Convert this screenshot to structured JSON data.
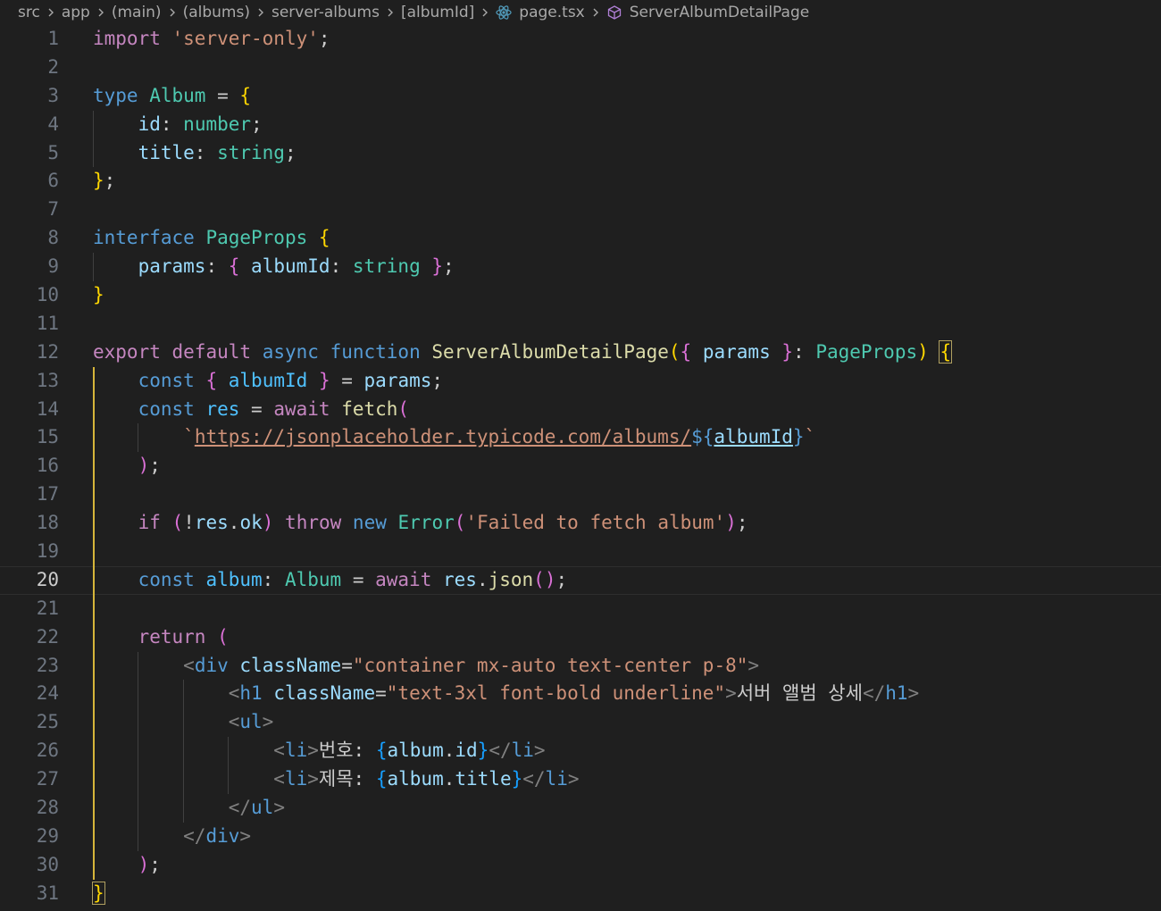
{
  "breadcrumb": {
    "items": [
      "src",
      "app",
      "(main)",
      "(albums)",
      "server-albums",
      "[albumId]"
    ],
    "file": "page.tsx",
    "symbol": "ServerAlbumDetailPage"
  },
  "editor": {
    "current_line": 20,
    "line_numbers": [
      "1",
      "2",
      "3",
      "4",
      "5",
      "6",
      "7",
      "8",
      "9",
      "10",
      "11",
      "12",
      "13",
      "14",
      "15",
      "16",
      "17",
      "18",
      "19",
      "20",
      "21",
      "22",
      "23",
      "24",
      "25",
      "26",
      "27",
      "28",
      "29",
      "30",
      "31"
    ],
    "lines": [
      [
        [
          "ctl",
          "import"
        ],
        [
          "pl",
          " "
        ],
        [
          "str",
          "'server-only'"
        ],
        [
          "pl",
          ";"
        ]
      ],
      [],
      [
        [
          "kw",
          "type"
        ],
        [
          "pl",
          " "
        ],
        [
          "ty",
          "Album"
        ],
        [
          "pl",
          " = "
        ],
        [
          "b1",
          "{"
        ]
      ],
      [
        [
          "pl",
          "    "
        ],
        [
          "var",
          "id"
        ],
        [
          "pl",
          ": "
        ],
        [
          "ty",
          "number"
        ],
        [
          "pl",
          ";"
        ]
      ],
      [
        [
          "pl",
          "    "
        ],
        [
          "var",
          "title"
        ],
        [
          "pl",
          ": "
        ],
        [
          "ty",
          "string"
        ],
        [
          "pl",
          ";"
        ]
      ],
      [
        [
          "b1",
          "}"
        ],
        [
          "pl",
          ";"
        ]
      ],
      [],
      [
        [
          "kw",
          "interface"
        ],
        [
          "pl",
          " "
        ],
        [
          "ty",
          "PageProps"
        ],
        [
          "pl",
          " "
        ],
        [
          "b1",
          "{"
        ]
      ],
      [
        [
          "pl",
          "    "
        ],
        [
          "var",
          "params"
        ],
        [
          "pl",
          ": "
        ],
        [
          "b2",
          "{"
        ],
        [
          "pl",
          " "
        ],
        [
          "var",
          "albumId"
        ],
        [
          "pl",
          ": "
        ],
        [
          "ty",
          "string"
        ],
        [
          "pl",
          " "
        ],
        [
          "b2",
          "}"
        ],
        [
          "pl",
          ";"
        ]
      ],
      [
        [
          "b1",
          "}"
        ]
      ],
      [],
      [
        [
          "ctl",
          "export"
        ],
        [
          "pl",
          " "
        ],
        [
          "ctl",
          "default"
        ],
        [
          "pl",
          " "
        ],
        [
          "kw",
          "async"
        ],
        [
          "pl",
          " "
        ],
        [
          "kw",
          "function"
        ],
        [
          "pl",
          " "
        ],
        [
          "fn",
          "ServerAlbumDetailPage"
        ],
        [
          "b1",
          "("
        ],
        [
          "b2",
          "{"
        ],
        [
          "pl",
          " "
        ],
        [
          "var",
          "params"
        ],
        [
          "pl",
          " "
        ],
        [
          "b2",
          "}"
        ],
        [
          "pl",
          ": "
        ],
        [
          "ty",
          "PageProps"
        ],
        [
          "b1",
          ")"
        ],
        [
          "pl",
          " "
        ],
        [
          "b1",
          "{"
        ]
      ],
      [
        [
          "pl",
          "    "
        ],
        [
          "kw",
          "const"
        ],
        [
          "pl",
          " "
        ],
        [
          "b2",
          "{"
        ],
        [
          "pl",
          " "
        ],
        [
          "const",
          "albumId"
        ],
        [
          "pl",
          " "
        ],
        [
          "b2",
          "}"
        ],
        [
          "pl",
          " = "
        ],
        [
          "var",
          "params"
        ],
        [
          "pl",
          ";"
        ]
      ],
      [
        [
          "pl",
          "    "
        ],
        [
          "kw",
          "const"
        ],
        [
          "pl",
          " "
        ],
        [
          "const",
          "res"
        ],
        [
          "pl",
          " = "
        ],
        [
          "ctl",
          "await"
        ],
        [
          "pl",
          " "
        ],
        [
          "fn",
          "fetch"
        ],
        [
          "b2",
          "("
        ]
      ],
      [
        [
          "pl",
          "        "
        ],
        [
          "str",
          "`"
        ],
        [
          "str",
          "https://jsonplaceholder.typicode.com/albums/"
        ],
        [
          "kw",
          "${"
        ],
        [
          "var",
          "albumId"
        ],
        [
          "kw",
          "}"
        ],
        [
          "str",
          "`"
        ]
      ],
      [
        [
          "pl",
          "    "
        ],
        [
          "b2",
          ")"
        ],
        [
          "pl",
          ";"
        ]
      ],
      [],
      [
        [
          "pl",
          "    "
        ],
        [
          "ctl",
          "if"
        ],
        [
          "pl",
          " "
        ],
        [
          "b2",
          "("
        ],
        [
          "pl",
          "!"
        ],
        [
          "var",
          "res"
        ],
        [
          "pl",
          "."
        ],
        [
          "var",
          "ok"
        ],
        [
          "b2",
          ")"
        ],
        [
          "pl",
          " "
        ],
        [
          "ctl",
          "throw"
        ],
        [
          "pl",
          " "
        ],
        [
          "kw",
          "new"
        ],
        [
          "pl",
          " "
        ],
        [
          "ty",
          "Error"
        ],
        [
          "b2",
          "("
        ],
        [
          "str",
          "'Failed to fetch album'"
        ],
        [
          "b2",
          ")"
        ],
        [
          "pl",
          ";"
        ]
      ],
      [],
      [
        [
          "pl",
          "    "
        ],
        [
          "kw",
          "const"
        ],
        [
          "pl",
          " "
        ],
        [
          "const",
          "album"
        ],
        [
          "pl",
          ": "
        ],
        [
          "ty",
          "Album"
        ],
        [
          "pl",
          " = "
        ],
        [
          "ctl",
          "await"
        ],
        [
          "pl",
          " "
        ],
        [
          "var",
          "res"
        ],
        [
          "pl",
          "."
        ],
        [
          "fn",
          "json"
        ],
        [
          "b2",
          "()"
        ],
        [
          "pl",
          ";"
        ]
      ],
      [],
      [
        [
          "pl",
          "    "
        ],
        [
          "ctl",
          "return"
        ],
        [
          "pl",
          " "
        ],
        [
          "b2",
          "("
        ]
      ],
      [
        [
          "pl",
          "        "
        ],
        [
          "tagp",
          "<"
        ],
        [
          "tag",
          "div"
        ],
        [
          "pl",
          " "
        ],
        [
          "attr",
          "className"
        ],
        [
          "pl",
          "="
        ],
        [
          "str",
          "\"container mx-auto text-center p-8\""
        ],
        [
          "tagp",
          ">"
        ]
      ],
      [
        [
          "pl",
          "            "
        ],
        [
          "tagp",
          "<"
        ],
        [
          "tag",
          "h1"
        ],
        [
          "pl",
          " "
        ],
        [
          "attr",
          "className"
        ],
        [
          "pl",
          "="
        ],
        [
          "str",
          "\"text-3xl font-bold underline\""
        ],
        [
          "tagp",
          ">"
        ],
        [
          "pl",
          "서버 앨범 상세"
        ],
        [
          "tagp",
          "</"
        ],
        [
          "tag",
          "h1"
        ],
        [
          "tagp",
          ">"
        ]
      ],
      [
        [
          "pl",
          "            "
        ],
        [
          "tagp",
          "<"
        ],
        [
          "tag",
          "ul"
        ],
        [
          "tagp",
          ">"
        ]
      ],
      [
        [
          "pl",
          "                "
        ],
        [
          "tagp",
          "<"
        ],
        [
          "tag",
          "li"
        ],
        [
          "tagp",
          ">"
        ],
        [
          "pl",
          "번호: "
        ],
        [
          "b3",
          "{"
        ],
        [
          "var",
          "album"
        ],
        [
          "pl",
          "."
        ],
        [
          "var",
          "id"
        ],
        [
          "b3",
          "}"
        ],
        [
          "tagp",
          "</"
        ],
        [
          "tag",
          "li"
        ],
        [
          "tagp",
          ">"
        ]
      ],
      [
        [
          "pl",
          "                "
        ],
        [
          "tagp",
          "<"
        ],
        [
          "tag",
          "li"
        ],
        [
          "tagp",
          ">"
        ],
        [
          "pl",
          "제목: "
        ],
        [
          "b3",
          "{"
        ],
        [
          "var",
          "album"
        ],
        [
          "pl",
          "."
        ],
        [
          "var",
          "title"
        ],
        [
          "b3",
          "}"
        ],
        [
          "tagp",
          "</"
        ],
        [
          "tag",
          "li"
        ],
        [
          "tagp",
          ">"
        ]
      ],
      [
        [
          "pl",
          "            "
        ],
        [
          "tagp",
          "</"
        ],
        [
          "tag",
          "ul"
        ],
        [
          "tagp",
          ">"
        ]
      ],
      [
        [
          "pl",
          "        "
        ],
        [
          "tagp",
          "</"
        ],
        [
          "tag",
          "div"
        ],
        [
          "tagp",
          ">"
        ]
      ],
      [
        [
          "pl",
          "    "
        ],
        [
          "b2",
          ")"
        ],
        [
          "pl",
          ";"
        ]
      ],
      [
        [
          "b1",
          "}"
        ]
      ]
    ]
  },
  "colors": {
    "background": "#1f1f1f",
    "active_guide": "#d6b53a"
  },
  "icons": {
    "separator": "chevron-right-icon",
    "file": "react-icon",
    "symbol": "cube-icon"
  }
}
